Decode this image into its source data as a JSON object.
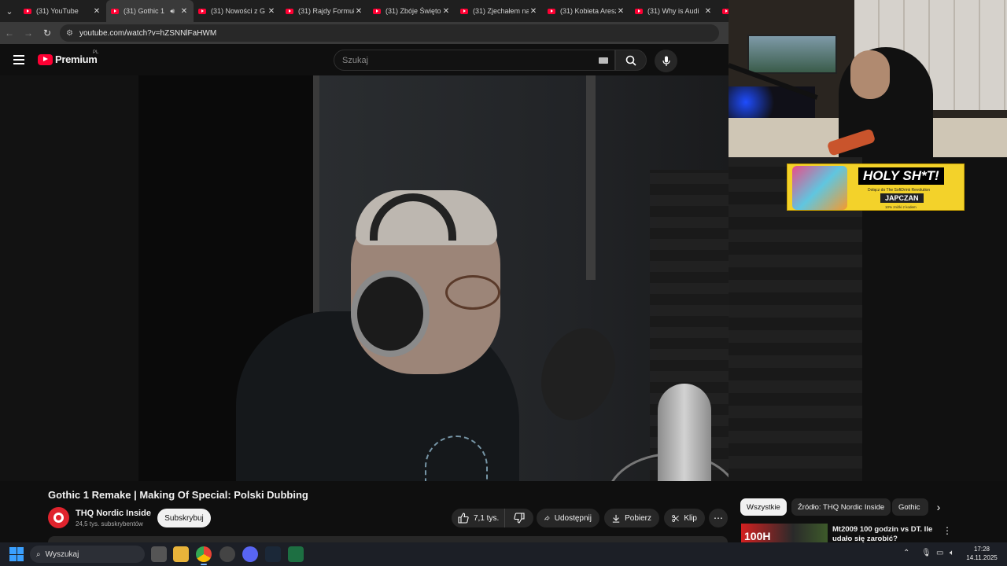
{
  "browser": {
    "tabs": [
      {
        "title": "(31) YouTube",
        "active": false,
        "audio": false
      },
      {
        "title": "(31) Gothic 1",
        "active": true,
        "audio": true
      },
      {
        "title": "(31) Nowości z G",
        "active": false,
        "audio": false
      },
      {
        "title": "(31) Rajdy Formuł",
        "active": false,
        "audio": false
      },
      {
        "title": "(31) Zbóje Święto",
        "active": false,
        "audio": false
      },
      {
        "title": "(31) Zjechałem na",
        "active": false,
        "audio": false
      },
      {
        "title": "(31) Kobieta Aresz",
        "active": false,
        "audio": false
      },
      {
        "title": "(31) Why is Audi",
        "active": false,
        "audio": false
      }
    ],
    "url": "youtube.com/watch?v=hZSNNlFaHWM"
  },
  "youtube": {
    "logo_text": "Premium",
    "region": "PL",
    "search_placeholder": "Szukaj",
    "video": {
      "title": "Gothic 1 Remake | Making Of Special: Polski Dubbing",
      "channel_name": "THQ Nordic Inside",
      "channel_subs": "24,5 tys. subskrybentów",
      "subscribe_label": "Subskrybuj",
      "like_count": "7,1 tys.",
      "share_label": "Udostępnij",
      "download_label": "Pobierz",
      "clip_label": "Klip"
    },
    "chips": [
      "Wszystkie",
      "Źródło: THQ Nordic Inside",
      "Gothic"
    ],
    "recommendation": {
      "thumb_text": "100H",
      "title": "Mt2009 100 godzin vs DT. Ile udało się zarobić?"
    }
  },
  "ad_banner": {
    "headline": "HOLY SH*T!",
    "sub": "Dołącz do The SoftDrink Revolution",
    "code": "JAPCZAN",
    "sub2": "10% zniżki z kodem"
  },
  "taskbar": {
    "search_placeholder": "Wyszukaj",
    "time": "17:28",
    "date": "14.11.2025"
  },
  "colors": {
    "yt_red": "#ff0033",
    "ad_yellow": "#f3d22a"
  }
}
